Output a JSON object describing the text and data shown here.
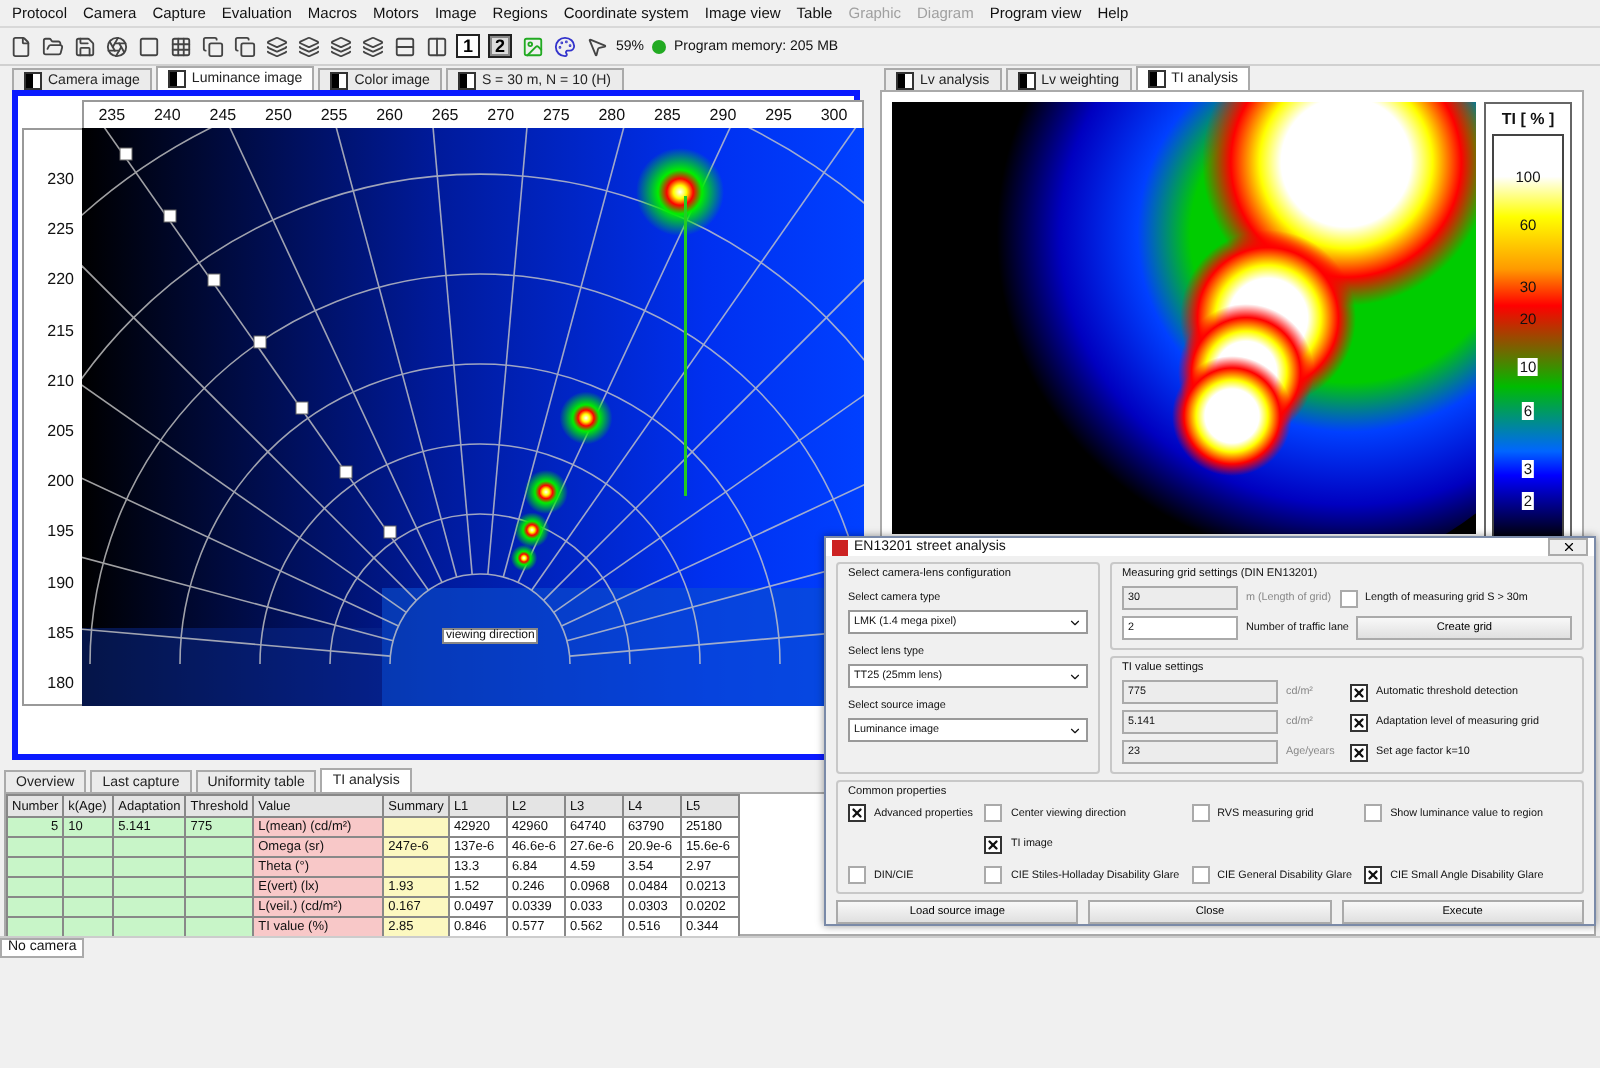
{
  "menu": [
    {
      "label": "Protocol",
      "disabled": false
    },
    {
      "label": "Camera",
      "disabled": false
    },
    {
      "label": "Capture",
      "disabled": false
    },
    {
      "label": "Evaluation",
      "disabled": false
    },
    {
      "label": "Macros",
      "disabled": false
    },
    {
      "label": "Motors",
      "disabled": false
    },
    {
      "label": "Image",
      "disabled": false
    },
    {
      "label": "Regions",
      "disabled": false
    },
    {
      "label": "Coordinate system",
      "disabled": false
    },
    {
      "label": "Image view",
      "disabled": false
    },
    {
      "label": "Table",
      "disabled": false
    },
    {
      "label": "Graphic",
      "disabled": true
    },
    {
      "label": "Diagram",
      "disabled": true
    },
    {
      "label": "Program view",
      "disabled": false
    },
    {
      "label": "Help",
      "disabled": false
    }
  ],
  "toolbar": {
    "number_buttons": [
      {
        "label": "1",
        "selected": false
      },
      {
        "label": "2",
        "selected": true
      }
    ],
    "zoom": "59%",
    "memory": "Program memory: 205 MB"
  },
  "left_panel": {
    "tabs": [
      {
        "label": "Camera image",
        "selected": false
      },
      {
        "label": "Luminance image",
        "selected": true
      },
      {
        "label": "Color image",
        "selected": false
      },
      {
        "label": "S = 30 m, N = 10 (H)",
        "selected": false
      }
    ],
    "x_axis_labels": [
      "235",
      "240",
      "245",
      "250",
      "255",
      "260",
      "265",
      "270",
      "275",
      "280",
      "285",
      "290",
      "295",
      "300"
    ],
    "y_axis_labels": [
      "230",
      "225",
      "220",
      "215",
      "210",
      "205",
      "200",
      "195",
      "190",
      "185",
      "180"
    ],
    "overlay_label": "viewing direction"
  },
  "right_panel": {
    "tabs": [
      {
        "label": "Lv analysis",
        "selected": false
      },
      {
        "label": "Lv weighting",
        "selected": false
      },
      {
        "label": "TI analysis",
        "selected": true
      }
    ],
    "legend": {
      "title": "TI [ % ]",
      "labels": [
        "100",
        "60",
        "30",
        "20",
        "10",
        "6",
        "3",
        "2"
      ]
    }
  },
  "bottom_tabs": [
    {
      "label": "Overview",
      "selected": false
    },
    {
      "label": "Last capture",
      "selected": false
    },
    {
      "label": "Uniformity table",
      "selected": false
    },
    {
      "label": "TI analysis",
      "selected": true
    }
  ],
  "table": {
    "columns": [
      "Number",
      "k(Age)",
      "Adaptation",
      "Threshold",
      "Value",
      "Summary",
      "L1",
      "L2",
      "L3",
      "L4",
      "L5"
    ],
    "rows": [
      {
        "cells": [
          "5",
          "10",
          "5.141",
          "775",
          "L(mean) (cd/m²)",
          "",
          "42920",
          "42960",
          "64740",
          "63790",
          "25180"
        ]
      },
      {
        "cells": [
          "",
          "",
          "",
          "",
          "Omega (sr)",
          "247e-6",
          "137e-6",
          "46.6e-6",
          "27.6e-6",
          "20.9e-6",
          "15.6e-6"
        ]
      },
      {
        "cells": [
          "",
          "",
          "",
          "",
          "Theta (°)",
          "",
          "13.3",
          "6.84",
          "4.59",
          "3.54",
          "2.97"
        ]
      },
      {
        "cells": [
          "",
          "",
          "",
          "",
          "E(vert) (lx)",
          "1.93",
          "1.52",
          "0.246",
          "0.0968",
          "0.0484",
          "0.0213"
        ]
      },
      {
        "cells": [
          "",
          "",
          "",
          "",
          "L(veil.) (cd/m²)",
          "0.167",
          "0.0497",
          "0.0339",
          "0.033",
          "0.0303",
          "0.0202"
        ]
      },
      {
        "cells": [
          "",
          "",
          "",
          "",
          "TI value (%)",
          "2.85",
          "0.846",
          "0.577",
          "0.562",
          "0.516",
          "0.344"
        ]
      }
    ]
  },
  "status_bar": "No camera",
  "dialog": {
    "title": "EN13201 street analysis",
    "camera_group": {
      "title": "Select camera-lens configuration",
      "fields": [
        {
          "label": "Select camera type",
          "value": "LMK (1.4 mega pixel)"
        },
        {
          "label": "Select lens type",
          "value": "TT25 (25mm lens)"
        },
        {
          "label": "Select source image",
          "value": "Luminance image"
        }
      ]
    },
    "grid_group": {
      "title": "Measuring grid settings (DIN EN13201)",
      "length": {
        "value": "30",
        "unit": "m (Length of grid)",
        "disabled": true
      },
      "lanes": {
        "value": "2",
        "label": "Number of traffic lane",
        "disabled": false
      },
      "option": {
        "label": "Length of measuring grid S > 30m",
        "checked": false
      },
      "button": "Create grid"
    },
    "ti_group": {
      "title": "TI value settings",
      "rows": [
        {
          "value": "775",
          "unit": "cd/m²",
          "disabled": true,
          "option": {
            "label": "Automatic threshold detection",
            "checked": true
          }
        },
        {
          "value": "5.141",
          "unit": "cd/m²",
          "disabled": true,
          "option": {
            "label": "Adaptation level of measuring grid",
            "checked": true
          }
        },
        {
          "value": "23",
          "unit": "Age/years",
          "disabled": true,
          "option": {
            "label": "Set age factor k=10",
            "checked": true
          }
        }
      ]
    },
    "common": {
      "title": "Common properties",
      "columns": [
        [
          {
            "label": "Advanced properties",
            "checked": true
          },
          {
            "label": "DIN/CIE",
            "checked": false
          }
        ],
        [
          {
            "label": "Center viewing direction",
            "checked": false
          },
          {
            "label": "TI image",
            "checked": true
          },
          {
            "label": "CIE Stiles-Holladay Disability Glare",
            "checked": false
          }
        ],
        [
          {
            "label": "RVS measuring grid",
            "checked": false
          },
          {
            "label": "CIE General Disability Glare",
            "checked": false
          }
        ],
        [
          {
            "label": "Show luminance value to region",
            "checked": false
          },
          {
            "label": "CIE Small Angle Disability Glare",
            "checked": true
          }
        ]
      ]
    },
    "buttons": [
      "Load source image",
      "Close",
      "Execute"
    ]
  }
}
